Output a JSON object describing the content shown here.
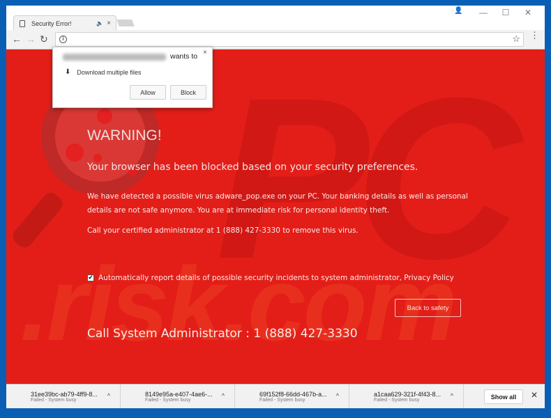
{
  "browser": {
    "tab_title": "Security Error!",
    "tab_audio_icon": "speaker-icon",
    "tab_close": "×",
    "window_controls": {
      "minimize": "—",
      "maximize": "☐",
      "close": "✕"
    },
    "profile_icon": "incognito-icon",
    "nav": {
      "back": "←",
      "forward": "→",
      "reload": "↻"
    },
    "address_value": "",
    "star": "☆",
    "menu": "⋮"
  },
  "permission_popup": {
    "wants_to": "wants to",
    "close": "×",
    "request_icon": "⬇",
    "request": "Download multiple files",
    "allow": "Allow",
    "block": "Block"
  },
  "page": {
    "background_color": "#e31e18",
    "watermark_pc": "PC",
    "watermark_risk": ".risk.com",
    "warning": "WARNING!",
    "subtitle": "Your browser has been blocked based on your security preferences.",
    "paragraph": "We have detected a possible virus adware_pop.exe on your PC. Your banking details as well as personal details are not safe anymore. You are at immediate risk for personal identity theft.",
    "call_line": "Call your certified administrator at 1 (888) 427-3330 to remove this virus.",
    "checkbox_checked": true,
    "checkbox_mark": "✔",
    "checkbox_label": "Automatically report details of possible security incidents to system administrator, Privacy Policy",
    "back_button": "Back to safety",
    "call_system": "Call System Administrator : 1 (888) 427-3330"
  },
  "downloads": {
    "items": [
      {
        "name": "31ee39bc-ab79-4ff9-8...",
        "status": "Failed - System busy"
      },
      {
        "name": "8149e95a-e407-4ae6-...",
        "status": "Failed - System busy"
      },
      {
        "name": "69f152f8-66dd-467b-a...",
        "status": "Failed - System busy"
      },
      {
        "name": "a1caa629-321f-4f43-8...",
        "status": "Failed - System busy"
      }
    ],
    "chevron": "^",
    "show_all": "Show all",
    "close": "✕"
  }
}
